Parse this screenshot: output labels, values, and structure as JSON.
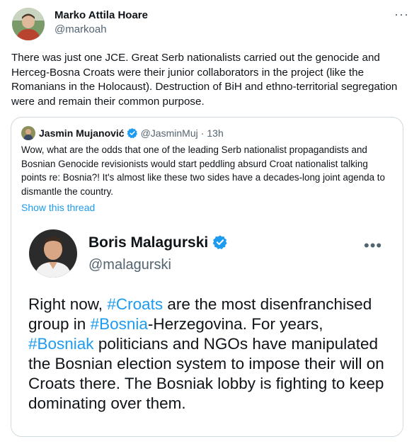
{
  "tweet": {
    "author_name": "Marko Attila Hoare",
    "author_handle": "@markoah",
    "more_glyph": "···",
    "body": "There was just one JCE. Great Serb nationalists carried out the genocide and Herceg-Bosna Croats were their junior collaborators in the project (like the Romanians in the Holocaust).  Destruction of BiH and ethno-territorial segregation were and remain their common purpose."
  },
  "quote": {
    "author_name": "Jasmin Mujanović",
    "author_handle": "@JasminMuj",
    "separator": "·",
    "time": "13h",
    "text": "Wow, what are the odds that one of the leading Serb nationalist propagandists and Bosnian Genocide revisionists would start peddling absurd Croat nationalist talking points re: Bosnia?! It's almost like these two sides have a decades-long joint agenda to dismantle the country.",
    "show_thread": "Show this thread"
  },
  "embedded_card": {
    "author_name": "Boris Malagurski",
    "author_handle": "@malagurski",
    "more_glyph": "•••",
    "text_segments": [
      {
        "text": "Right now, ",
        "hashtag": false
      },
      {
        "text": "#Croats",
        "hashtag": true
      },
      {
        "text": " are the most disenfranchised group in ",
        "hashtag": false
      },
      {
        "text": "#Bosnia",
        "hashtag": true
      },
      {
        "text": "-Herzegovina. For years, ",
        "hashtag": false
      },
      {
        "text": "#Bosniak",
        "hashtag": true
      },
      {
        "text": " politicians and NGOs have manipulated the Bosnian election system to impose their will on Croats there. The Bosniak lobby is fighting to keep dominating over them.",
        "hashtag": false
      }
    ]
  },
  "colors": {
    "text": "#0f1419",
    "secondary": "#536471",
    "link": "#1d9bf0",
    "verified": "#1d9bf0",
    "border": "#cfd9de"
  },
  "icons": [
    "verified-badge-icon",
    "more-options-icon"
  ]
}
